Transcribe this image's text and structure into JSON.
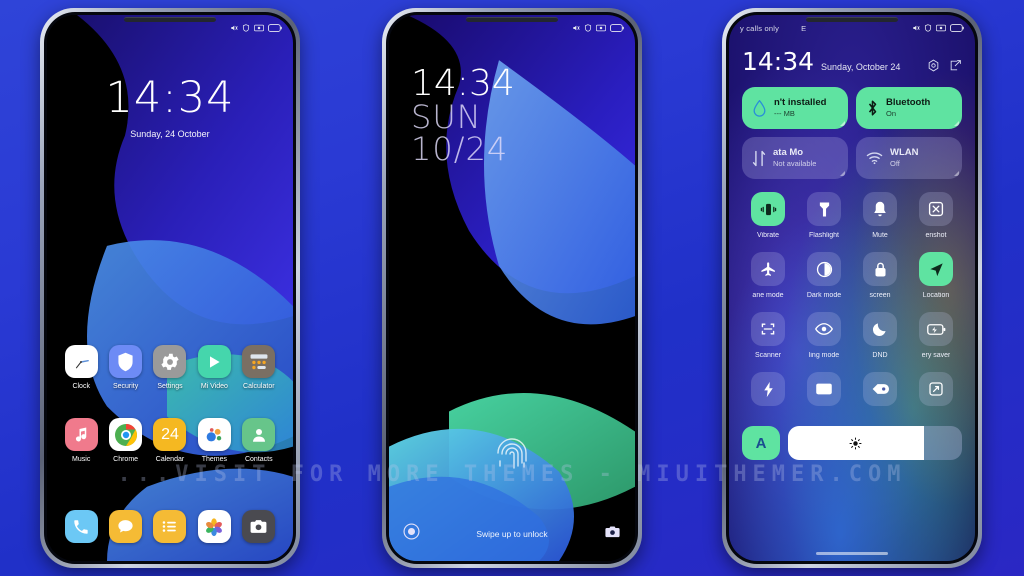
{
  "background": {
    "color_top": "#2f44d8",
    "color_bottom": "#2a27c4"
  },
  "watermark": {
    "text": "...VISIT FOR MORE THEMES - MIUITHEMER.COM"
  },
  "phone1": {
    "statusbar": {
      "left_items": [],
      "icons": [
        "silent-icon",
        "shield-icon",
        "alarm-icon",
        "battery-icon"
      ]
    },
    "clock": {
      "time": "14:34",
      "date": "Sunday, 24 October"
    },
    "apps_row1": [
      {
        "label": "Clock",
        "icon": "clock-icon",
        "bg": "#ffffff"
      },
      {
        "label": "Security",
        "icon": "shield-icon",
        "bg": "#6d8bf5"
      },
      {
        "label": "Settings",
        "icon": "gear-icon",
        "bg": "#9a9a9a"
      },
      {
        "label": "Mi Video",
        "icon": "play-icon",
        "bg": "#45d6ac"
      },
      {
        "label": "Calculator",
        "icon": "calculator-icon",
        "bg": "#7a6f63"
      }
    ],
    "apps_row2": [
      {
        "label": "Music",
        "icon": "music-note-icon",
        "bg": "#f07a8c"
      },
      {
        "label": "Chrome",
        "icon": "chrome-icon",
        "bg": "#ffffff"
      },
      {
        "label": "Calendar",
        "icon": "calendar-icon",
        "bg": "#f5b821",
        "day": "24"
      },
      {
        "label": "Themes",
        "icon": "themes-icon",
        "bg": "#ffffff"
      },
      {
        "label": "Contacts",
        "icon": "contact-icon",
        "bg": "#67c58a"
      }
    ],
    "dock": [
      {
        "label": "Phone",
        "icon": "phone-icon",
        "bg": "#6cc8f5"
      },
      {
        "label": "Messages",
        "icon": "message-icon",
        "bg": "#f5bb35"
      },
      {
        "label": "Notes",
        "icon": "notes-icon",
        "bg": "#f5bb35"
      },
      {
        "label": "Gallery",
        "icon": "gallery-icon",
        "bg": "#ffffff"
      },
      {
        "label": "Camera",
        "icon": "camera-icon",
        "bg": "#4a4a50"
      }
    ]
  },
  "phone2": {
    "statusbar": {
      "icons": [
        "silent-icon",
        "shield-icon",
        "alarm-icon",
        "battery-icon"
      ]
    },
    "clock": {
      "time": "14:34",
      "weekday": "SUN",
      "date": "10/24"
    },
    "fingerprint": "fingerprint-icon",
    "hint": "Swipe up to unlock",
    "left_shortcut": "record-icon",
    "right_shortcut": "camera-icon"
  },
  "phone3": {
    "statusbar": {
      "carrier": "y calls only",
      "secondary": "E",
      "icons": [
        "silent-icon",
        "shield-icon",
        "alarm-icon",
        "battery-icon"
      ]
    },
    "header": {
      "time": "14:34",
      "date": "Sunday, October 24",
      "settings_icon": "gear-hex-icon",
      "edit_icon": "edit-icon"
    },
    "big_tiles": [
      {
        "title": "n't installed",
        "sub": "--- MB",
        "icon": "data-drop-icon",
        "state": "on"
      },
      {
        "title": "Bluetooth",
        "sub": "On",
        "icon": "bluetooth-icon",
        "state": "on"
      },
      {
        "title": "ata          Mo",
        "sub": "Not available",
        "icon": "mobile-data-icon",
        "state": "off"
      },
      {
        "title": "WLAN",
        "sub": "Off",
        "icon": "wifi-icon",
        "state": "off"
      }
    ],
    "toggles_row1": [
      {
        "label": "Vibrate",
        "icon": "vibrate-icon",
        "active": true
      },
      {
        "label": "Flashlight",
        "icon": "flashlight-icon",
        "active": false
      },
      {
        "label": "Mute",
        "icon": "bell-icon",
        "active": false
      },
      {
        "label": "enshot",
        "icon": "screenshot-icon",
        "active": false
      }
    ],
    "toggles_row2": [
      {
        "label": "ane mode",
        "icon": "airplane-icon",
        "active": false
      },
      {
        "label": "Dark mode",
        "icon": "dark-mode-icon",
        "active": false
      },
      {
        "label": "screen",
        "icon": "lock-icon",
        "active": false
      },
      {
        "label": "Location",
        "icon": "location-arrow-icon",
        "active": true
      }
    ],
    "toggles_row3": [
      {
        "label": "Scanner",
        "icon": "scanner-icon",
        "active": false
      },
      {
        "label": "ling mode",
        "icon": "eye-icon",
        "active": false
      },
      {
        "label": "DND",
        "icon": "moon-icon",
        "active": false
      },
      {
        "label": "ery saver",
        "icon": "battery-saver-icon",
        "active": false
      }
    ],
    "toggles_row4": [
      {
        "label": "",
        "icon": "lightning-icon",
        "active": false
      },
      {
        "label": "",
        "icon": "cast-icon",
        "active": false
      },
      {
        "label": "",
        "icon": "tag-icon",
        "active": false
      },
      {
        "label": "",
        "icon": "rotate-icon",
        "active": false
      }
    ],
    "brightness": {
      "auto_label": "A",
      "value": 78,
      "icon": "sun-icon"
    }
  }
}
